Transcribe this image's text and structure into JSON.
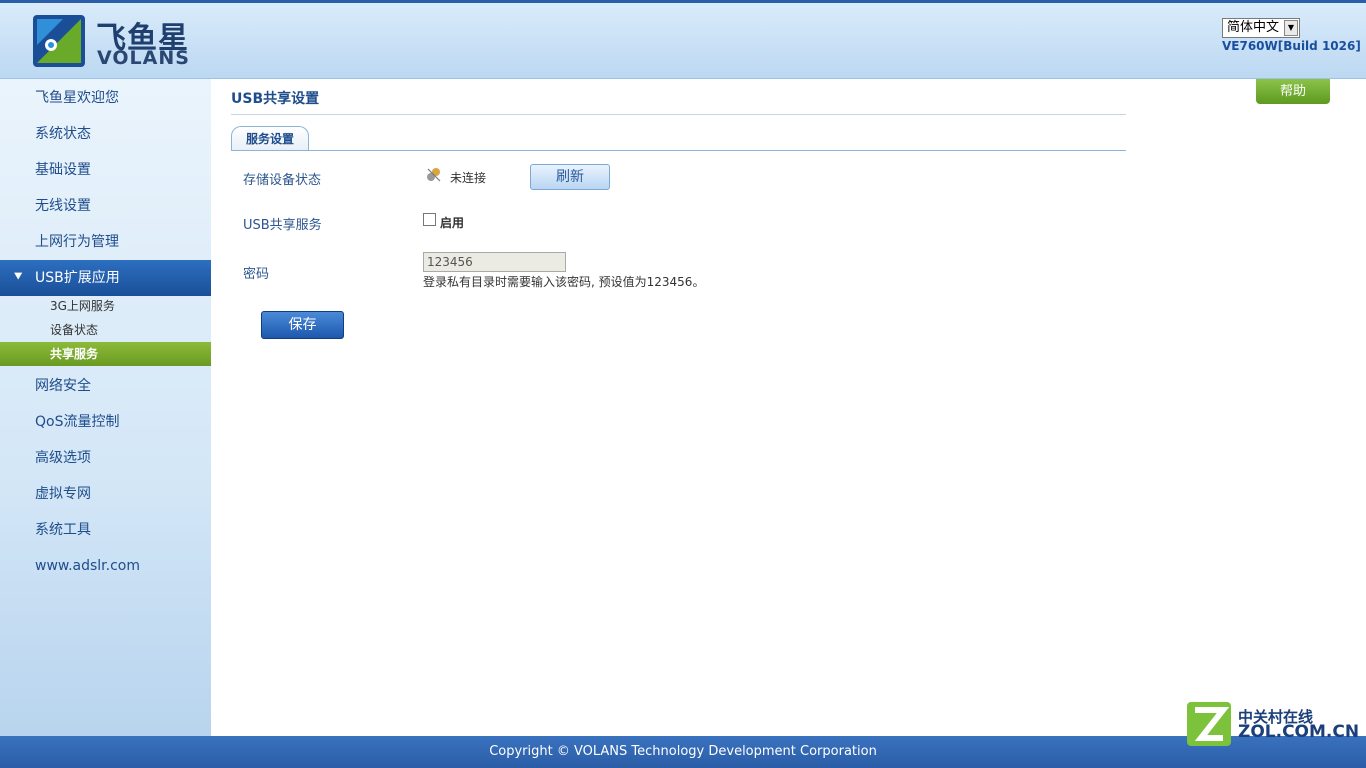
{
  "brand": {
    "cn": "飞鱼星",
    "en": "VOLANS"
  },
  "header": {
    "language": "简体中文",
    "version": "VE760W[Build 1026]"
  },
  "sidebar": {
    "items": [
      {
        "label": "飞鱼星欢迎您"
      },
      {
        "label": "系统状态"
      },
      {
        "label": "基础设置"
      },
      {
        "label": "无线设置"
      },
      {
        "label": "上网行为管理"
      },
      {
        "label": "USB扩展应用"
      },
      {
        "label": "网络安全"
      },
      {
        "label": "QoS流量控制"
      },
      {
        "label": "高级选项"
      },
      {
        "label": "虚拟专网"
      },
      {
        "label": "系统工具"
      },
      {
        "label": "www.adslr.com"
      }
    ],
    "sub_items": [
      {
        "label": "3G上网服务"
      },
      {
        "label": "设备状态"
      },
      {
        "label": "共享服务"
      }
    ],
    "active_icon": "double-chevron-down-icon"
  },
  "main": {
    "title": "USB共享设置",
    "help": "帮助",
    "tab": "服务设置",
    "storage_label": "存储设备状态",
    "storage_status": "未连接",
    "refresh": "刷新",
    "usb_share_label": "USB共享服务",
    "enable_label": "启用",
    "password_label": "密码",
    "password_value": "123456",
    "password_hint": "登录私有目录时需要输入该密码, 预设值为123456。",
    "save": "保存"
  },
  "footer": {
    "copyright": "Copyright © VOLANS Technology Development Corporation"
  },
  "watermark": {
    "cn": "中关村在线",
    "en": "ZOL.COM.CN"
  }
}
